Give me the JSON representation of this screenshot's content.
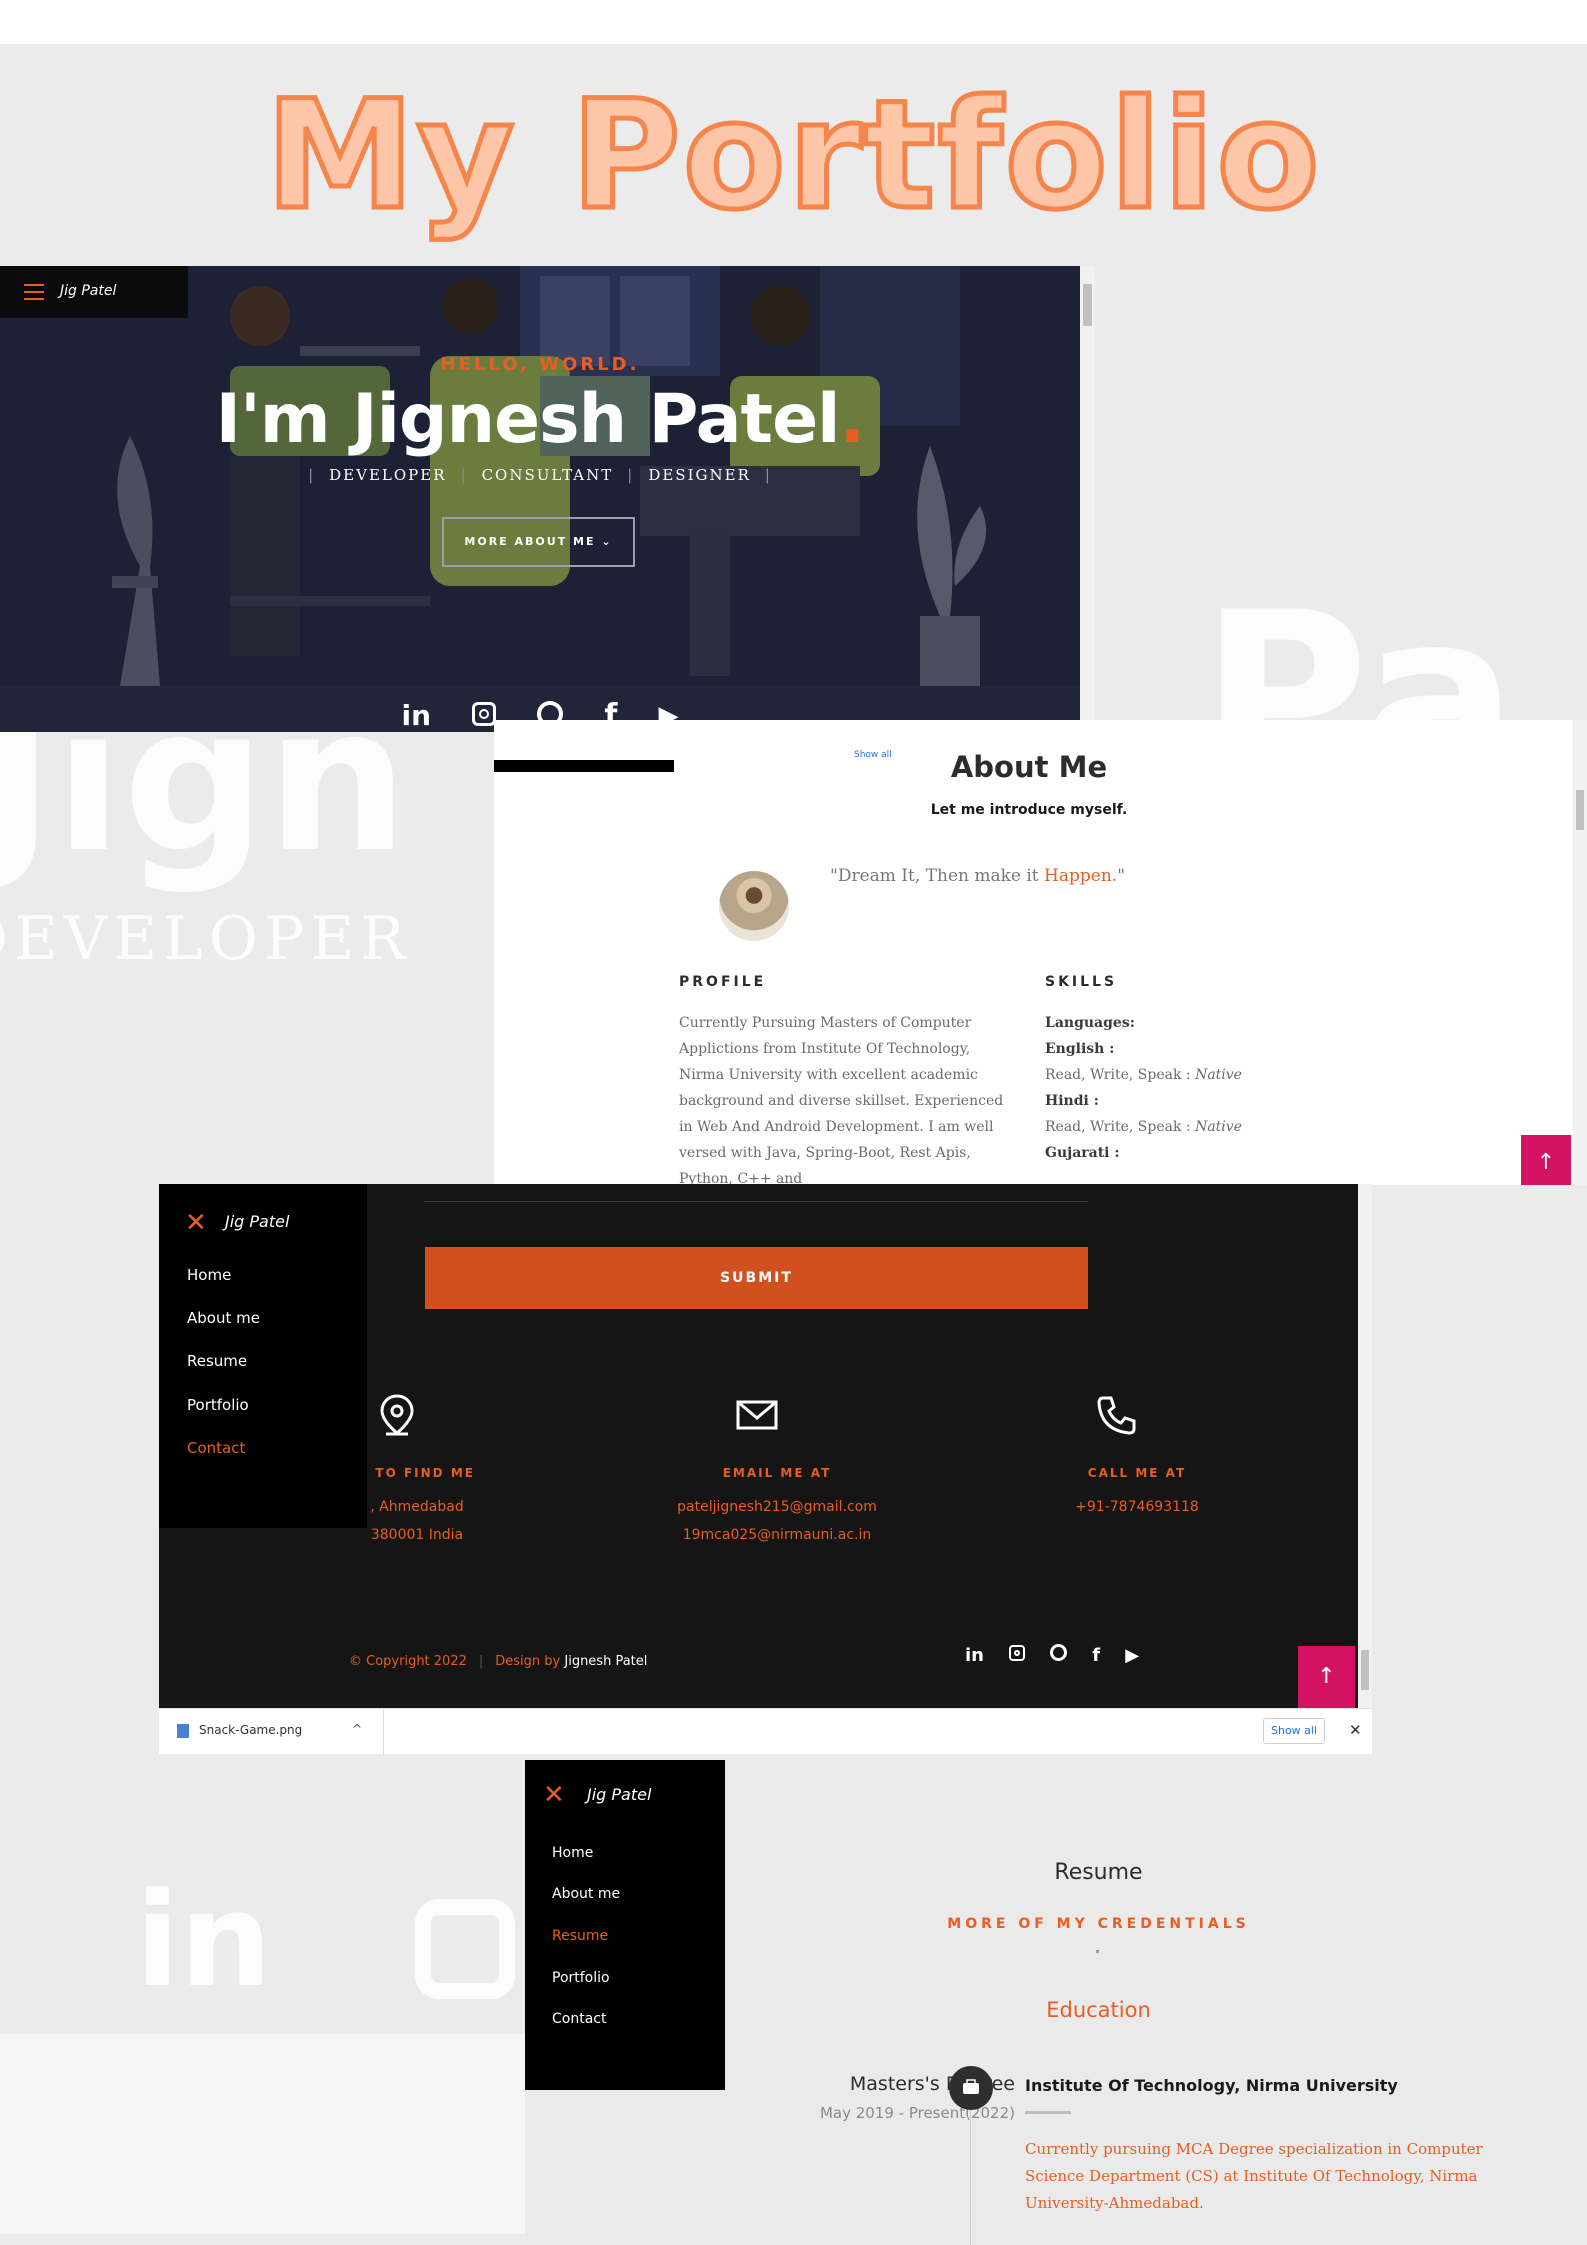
{
  "page": {
    "heading": "My Portfolio",
    "background_words": {
      "big_name": "Jign",
      "role": "DEVELOPER",
      "right": "Pa"
    }
  },
  "colors": {
    "accent": "#e95d21",
    "hero_bg": "#1c2135",
    "heading_fill": "#fdc6a8",
    "heading_stroke": "#f5854a",
    "to_top": "#d31263",
    "contact_bg": "#151515"
  },
  "hero": {
    "brand": "Jig Patel",
    "menu_icon": "hamburger-icon",
    "greeting": "HELLO, WORLD.",
    "name": "I'm Jignesh Patel",
    "name_dot": ".",
    "roles": [
      "DEVELOPER",
      "CONSULTANT",
      "DESIGNER"
    ],
    "more_button": "MORE ABOUT ME",
    "more_button_icon": "chevron-down-icon",
    "social": [
      {
        "icon": "linkedin-icon",
        "glyph": "in"
      },
      {
        "icon": "instagram-icon",
        "glyph": ""
      },
      {
        "icon": "github-icon",
        "glyph": ""
      },
      {
        "icon": "facebook-icon",
        "glyph": "f"
      },
      {
        "icon": "youtube-icon",
        "glyph": "▶"
      }
    ]
  },
  "about": {
    "download_peek": "Snack-Game.png",
    "show_all_peek": "Show all",
    "title": "About Me",
    "subtitle": "Let me introduce myself.",
    "quote_prefix": "\"Dream It, Then make it ",
    "quote_highlight": "Happen.",
    "quote_suffix": "\"",
    "profile_heading": "PROFILE",
    "profile_text": "Currently Pursuing Masters of Computer Applictions from Institute Of Technology, Nirma University with excellent academic background and diverse skillset. Experienced in Web And Android Development. I am well versed with Java, Spring-Boot, Rest Apis, Python, C++ and",
    "skills_heading": "SKILLS",
    "skills": {
      "languages_label": "Languages:",
      "english_label": "English :",
      "english_value_prefix": "Read, Write, Speak : ",
      "english_value": "Native",
      "hindi_label": "Hindi :",
      "hindi_value_prefix": "Read, Write, Speak : ",
      "hindi_value": "Native",
      "gujarati_label": "Gujarati :"
    },
    "to_top": "↑"
  },
  "contact": {
    "submit": "SUBMIT",
    "menu": {
      "brand": "Jig Patel",
      "close_icon": "close-icon",
      "items": [
        "Home",
        "About me",
        "Resume",
        "Portfolio",
        "Contact"
      ],
      "active": "Contact"
    },
    "columns": [
      {
        "icon": "map-pin-icon",
        "heading": "E TO FIND ME",
        "lines": [
          ", Ahmedabad",
          "380001 India"
        ]
      },
      {
        "icon": "envelope-icon",
        "heading": "EMAIL ME AT",
        "lines": [
          "pateljignesh215@gmail.com",
          "19mca025@nirmauni.ac.in"
        ]
      },
      {
        "icon": "phone-icon",
        "heading": "CALL ME AT",
        "lines": [
          "+91-7874693118"
        ]
      }
    ],
    "copyright": "© Copyright 2022",
    "design_by_label": "Design by",
    "design_by_name": "Jignesh Patel",
    "social": [
      {
        "icon": "linkedin-icon",
        "glyph": "in"
      },
      {
        "icon": "instagram-icon",
        "glyph": ""
      },
      {
        "icon": "github-icon",
        "glyph": ""
      },
      {
        "icon": "facebook-icon",
        "glyph": "f"
      },
      {
        "icon": "youtube-icon",
        "glyph": "▶"
      }
    ],
    "to_top": "↑"
  },
  "download_bar": {
    "file": "Snack-Game.png",
    "chevron": "^",
    "show_all": "Show all",
    "close": "✕"
  },
  "resume": {
    "menu": {
      "brand": "Jig Patel",
      "close_icon": "close-icon",
      "items": [
        "Home",
        "About me",
        "Resume",
        "Portfolio",
        "Contact"
      ],
      "active": "Resume"
    },
    "title": "Resume",
    "subtitle": "MORE OF MY CREDENTIALS",
    "section": "Education",
    "entry": {
      "degree": "Masters's Degree",
      "date": "May 2019 - Present(2022)",
      "badge_icon": "briefcase-icon",
      "institute": "Institute Of Technology, Nirma University",
      "description": "Currently pursuing MCA Degree specialization in Computer Science Department (CS) at Institute Of Technology, Nirma University-Ahmedabad."
    }
  }
}
